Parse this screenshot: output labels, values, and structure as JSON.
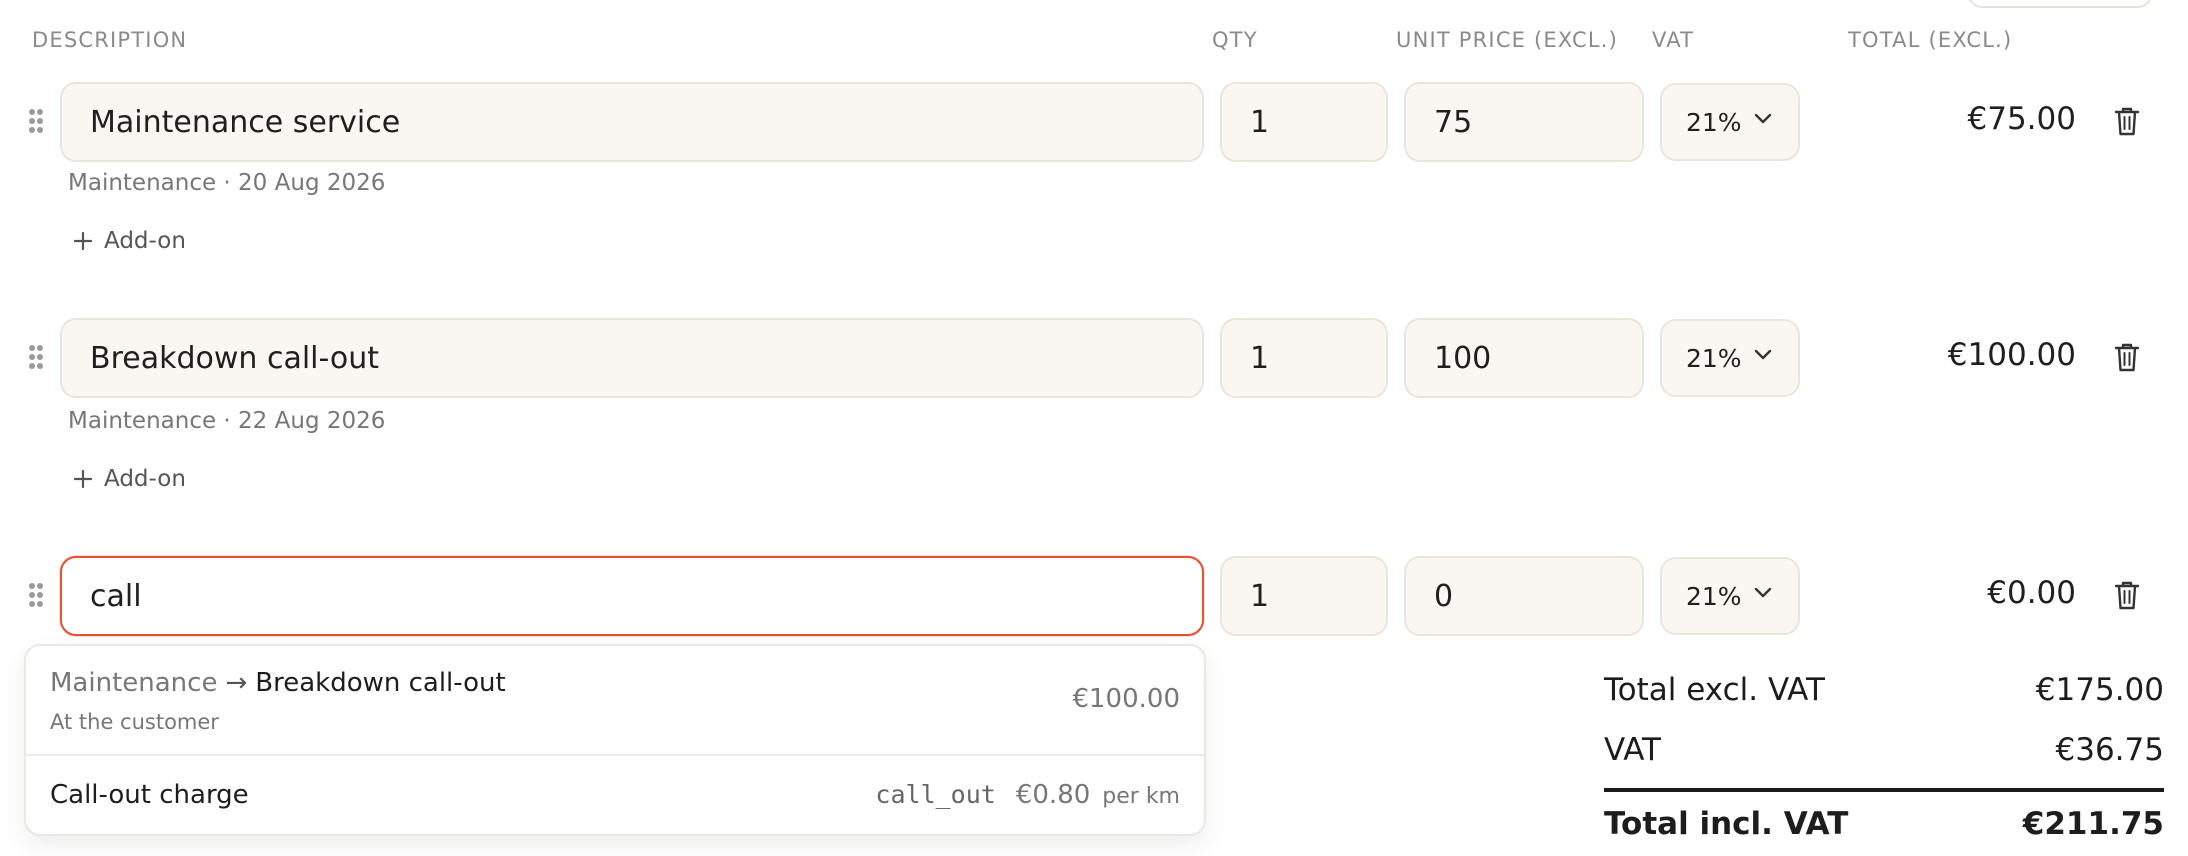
{
  "columns": {
    "description": "DESCRIPTION",
    "qty": "QTY",
    "unit_price": "UNIT PRICE (EXCL.)",
    "vat": "VAT",
    "total": "TOTAL (EXCL.)"
  },
  "lines": [
    {
      "description": "Maintenance service",
      "qty": "1",
      "unit_price": "75",
      "vat": "21%",
      "total": "€75.00",
      "meta": "Maintenance · 20 Aug 2026",
      "addon_label": "Add-on"
    },
    {
      "description": "Breakdown call-out",
      "qty": "1",
      "unit_price": "100",
      "vat": "21%",
      "total": "€100.00",
      "meta": "Maintenance · 22 Aug 2026",
      "addon_label": "Add-on"
    },
    {
      "description": "call",
      "qty": "1",
      "unit_price": "0",
      "vat": "21%",
      "total": "€0.00"
    }
  ],
  "suggestions": [
    {
      "category": "Maintenance",
      "arrow": "→",
      "name": "Breakdown call-out",
      "subtitle": "At the customer",
      "price": "€100.00"
    },
    {
      "name": "Call-out charge",
      "code": "call_out",
      "price": "€0.80",
      "unit": "per km"
    }
  ],
  "summary": {
    "total_excl_label": "Total excl. VAT",
    "total_excl_value": "€175.00",
    "vat_label": "VAT",
    "vat_value": "€36.75",
    "total_incl_label": "Total incl. VAT",
    "total_incl_value": "€211.75"
  },
  "colors": {
    "field_bg": "#faf7f2",
    "field_border": "#ece5db",
    "active_border": "#e2532f",
    "muted_text": "#8a8a8a"
  },
  "icons": [
    "drag-handle-icon",
    "trash-icon",
    "chevron-down-icon",
    "plus-icon",
    "arrow-right-icon"
  ]
}
